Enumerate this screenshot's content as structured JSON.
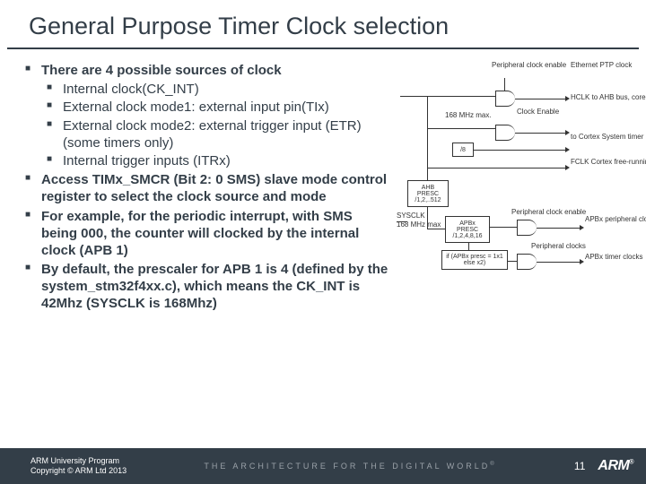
{
  "title": "General Purpose Timer Clock selection",
  "bullets": {
    "b1": "There are 4 possible sources of clock",
    "s1": "Internal clock(CK_INT)",
    "s2": "External clock mode1: external input pin(TIx)",
    "s3": "External clock mode2: external trigger input (ETR) (some timers only)",
    "s4": "Internal trigger inputs (ITRx)",
    "b2": "Access TIMx_SMCR (Bit 2: 0 SMS) slave mode control register to select the clock source and mode",
    "b3": "For example, for the periodic interrupt, with SMS being 000, the counter will clocked by the internal clock (APB 1)",
    "b4": "By default, the prescaler for APB 1 is 4 (defined by the system_stm32f4xx.c), which means the CK_INT is 42Mhz (SYSCLK is 168Mhz)"
  },
  "diagram": {
    "periph_en": "Peripheral\nclock enable",
    "eth": "Ethernet\nPTP clock",
    "mhz168": "168 MHz max.",
    "clk_en": "Clock\nEnable",
    "hclk": "HCLK\nto AHB bus, core,\nmemory and DMA",
    "cortex": "to Cortex System\ntimer",
    "fclk": "FCLK Cortex\nfree-running clock",
    "div8": "/8",
    "ahb_presc": "AHB\nPRESC\n/1,2,..512",
    "sysclk": "SYSCLK",
    "mhz168b": "168 MHz\nmax",
    "apbx_presc": "APBx\nPRESC\n/1,2,4,8,16",
    "if_cond": "if (APBx presc = 1x1\nelse x2)",
    "periph_en2": "Peripheral clock enable",
    "apbx_periph": "APBx\nperipheral\nclocks",
    "periph_en3": "Peripheral\nclocks",
    "apbx_timer": "APBx timer\nclocks"
  },
  "footer": {
    "prog1": "ARM University Program",
    "prog2": "Copyright © ARM Ltd 2013",
    "tagline": "THE ARCHITECTURE FOR THE DIGITAL WORLD",
    "page": "11",
    "logo": "ARM"
  }
}
